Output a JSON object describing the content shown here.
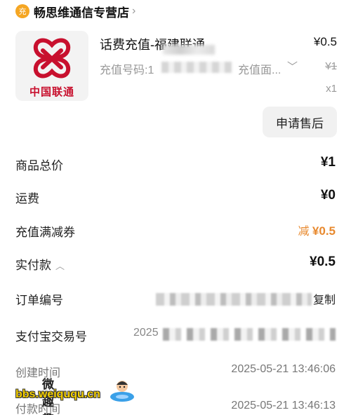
{
  "store": {
    "badge": "充",
    "name": "畅思维通信专营店"
  },
  "product": {
    "logo_text": "中国联通",
    "title": "话费充值-福建联通",
    "price": "¥0.5",
    "number_label": "充值号码:1",
    "spec": "充值面...",
    "original_price": "¥1",
    "quantity": "x1"
  },
  "actions": {
    "aftersale": "申请售后",
    "copy": "复制"
  },
  "summary": {
    "goods_total_label": "商品总价",
    "goods_total_value": "¥1",
    "shipping_label": "运费",
    "shipping_value": "¥0",
    "coupon_label": "充值满减券",
    "coupon_prefix": "减",
    "coupon_value": "¥0.5",
    "paid_label": "实付款",
    "paid_value": "¥0.5"
  },
  "order": {
    "number_label": "订单编号",
    "alipay_label": "支付宝交易号",
    "alipay_prefix": "2025",
    "created_label": "创建时间",
    "created_value": "2025-05-21 13:46:06",
    "paid_time_label": "付款时间",
    "paid_time_value": "2025-05-21 13:46:13"
  },
  "watermark": {
    "site_cn": "微趣趣",
    "url": "bbs.weiququ.cn"
  },
  "colors": {
    "brand_red": "#c8102e",
    "discount_orange": "#e8892e",
    "badge_orange": "#f5a623"
  }
}
